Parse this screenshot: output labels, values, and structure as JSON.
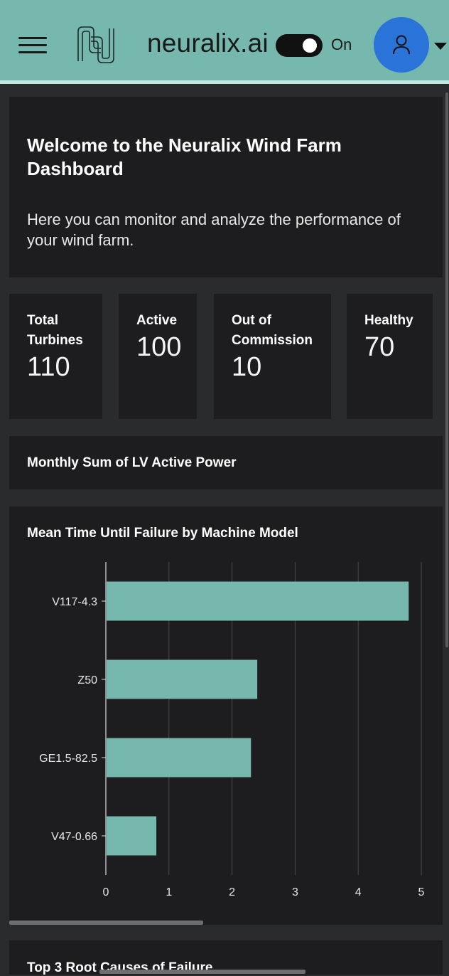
{
  "header": {
    "brand": "neuralix.ai",
    "toggle_state": "On",
    "menu_icon": "hamburger-menu-icon",
    "logo_icon": "neuralix-logo-icon",
    "avatar_icon": "user-icon",
    "dropdown_icon": "caret-down-icon",
    "accent_color": "#76b8ad",
    "avatar_color": "#2a73d9"
  },
  "welcome": {
    "title": "Welcome to the Neuralix Wind Farm Dashboard",
    "subtitle": "Here you can monitor and analyze the performance of your wind farm."
  },
  "stats": [
    {
      "label": "Total Turbines",
      "value": "110"
    },
    {
      "label": "Active",
      "value": "100"
    },
    {
      "label": "Out of Commission",
      "value": "10"
    },
    {
      "label": "Healthy",
      "value": "70"
    }
  ],
  "sections": {
    "power_title": "Monthly Sum of LV Active Power",
    "root_causes_title": "Top 3 Root Causes of Failure"
  },
  "chart_data": {
    "type": "bar",
    "orientation": "horizontal",
    "title": "Mean Time Until Failure by Machine Model",
    "categories": [
      "V117-4.3",
      "Z50",
      "GE1.5-82.5",
      "V47-0.66"
    ],
    "values": [
      4.8,
      2.4,
      2.3,
      0.8
    ],
    "xlim": [
      0,
      5
    ],
    "xticks": [
      "0",
      "1",
      "2",
      "3",
      "4",
      "5"
    ],
    "grid": true,
    "bar_color": "#76b8ad"
  }
}
